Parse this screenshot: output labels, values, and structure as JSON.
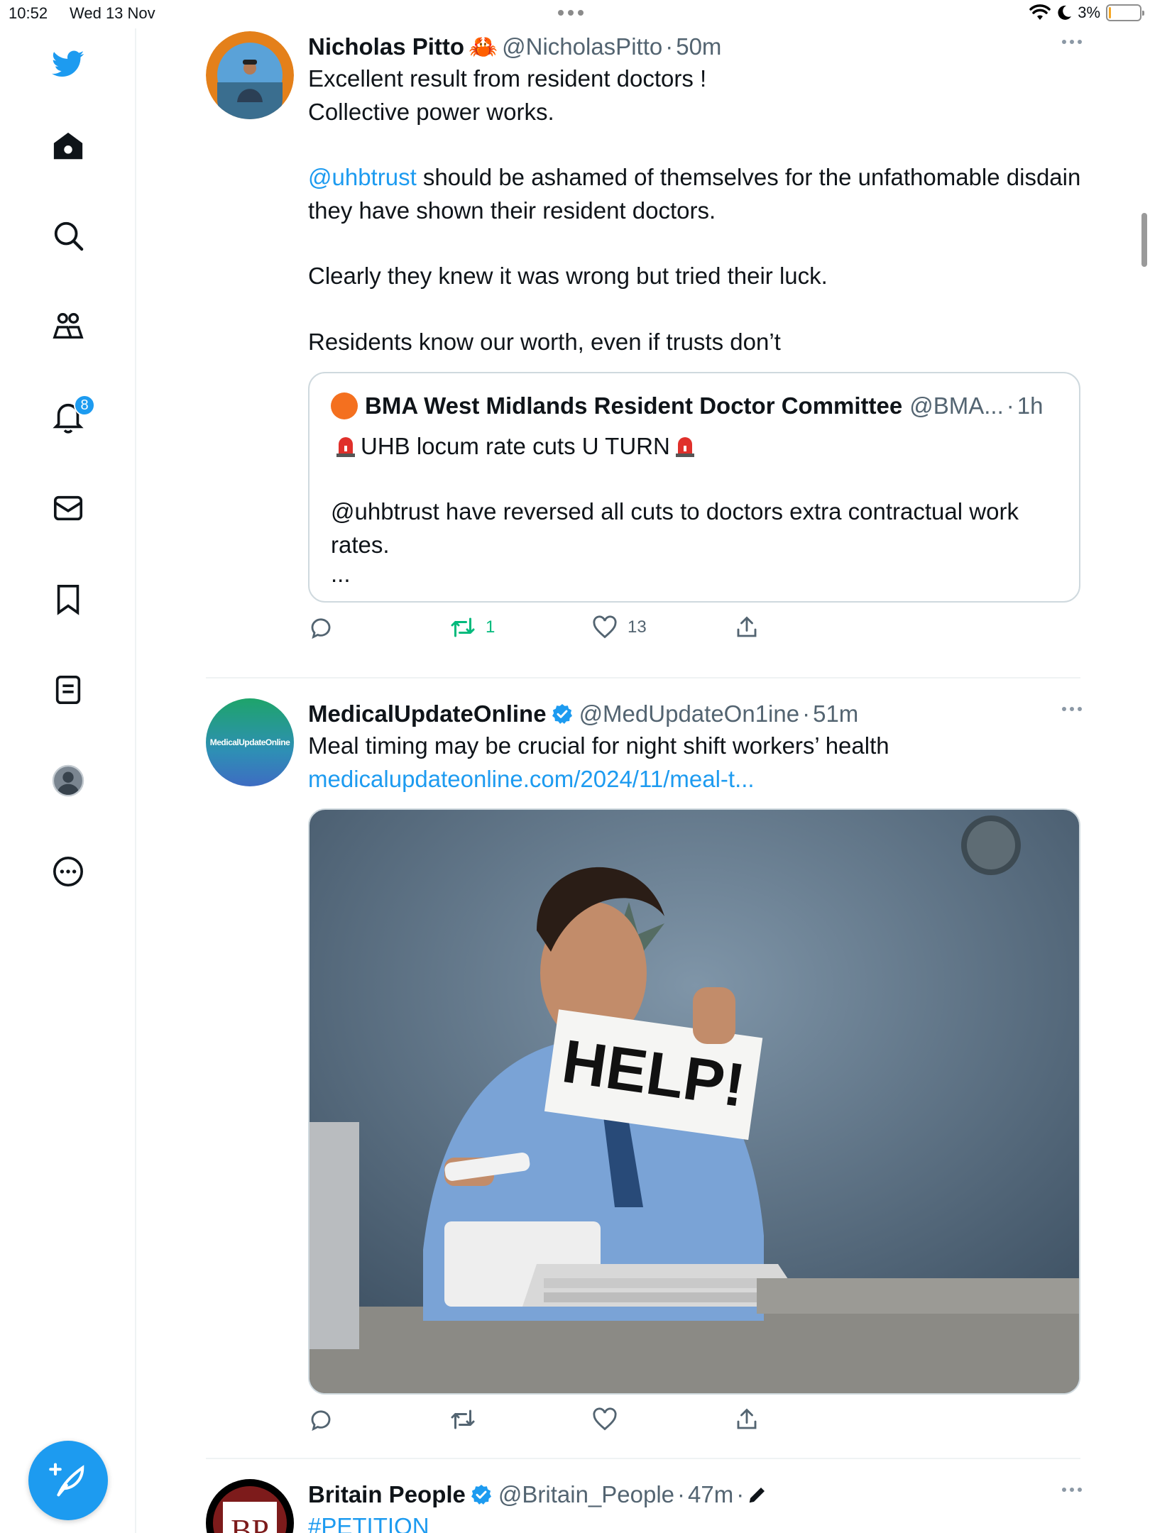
{
  "status_bar": {
    "time": "10:52",
    "date": "Wed 13 Nov",
    "battery": "3%",
    "battery_level": 0.03
  },
  "sidebar": {
    "items": [
      {
        "icon": "twitter-bird-logo-icon"
      },
      {
        "icon": "home-icon"
      },
      {
        "icon": "search-icon"
      },
      {
        "icon": "communities-icon"
      },
      {
        "icon": "notifications-bell-icon",
        "badge": "8"
      },
      {
        "icon": "messages-envelope-icon"
      },
      {
        "icon": "bookmark-icon"
      },
      {
        "icon": "lists-icon"
      },
      {
        "icon": "profile-avatar-icon"
      },
      {
        "icon": "more-circle-icon"
      }
    ],
    "compose_icon": "compose-feather-icon",
    "accent": "#1d9bf0"
  },
  "tweets": [
    {
      "name": "Nicholas Pitto",
      "emoji": "🦀",
      "handle": "@NicholasPitto",
      "sep": "·",
      "time": "50m",
      "text_1": "Excellent result from resident doctors !\nCollective power works.",
      "mention": "@uhbtrust",
      "text_2": " should be ashamed of themselves for the unfathomable disdain they have shown their resident doctors.",
      "text_3": "Clearly they knew it was wrong but tried their luck.\n\nResidents know our worth, even if trusts don’t",
      "quote": {
        "name": "BMA West Midlands Resident Doctor Committee",
        "handle": "@BMA...",
        "sep": "·",
        "time": "1h",
        "line_1": "UHB locum rate cuts U TURN",
        "line_2": "@uhbtrust have reversed all cuts to doctors extra contractual work rates.",
        "ellipsis": "..."
      },
      "actions": {
        "replies": "",
        "retweets": "1",
        "likes": "13"
      }
    },
    {
      "name": "MedicalUpdateOnline",
      "handle": "@MedUpdateOn1ine",
      "sep": "·",
      "time": "51m",
      "avatar_text": "MedicalUpdateOnline",
      "text": "Meal timing may be crucial for night shift workers’ health",
      "link": "medicalupdateonline.com/2024/11/meal-t...",
      "image_sign": "HELP!"
    },
    {
      "name": "Britain People",
      "handle": "@Britain_People",
      "sep": "·",
      "time": "47m",
      "sep2": "·",
      "avatar_text": "BP",
      "text": "#PETITION"
    }
  ]
}
